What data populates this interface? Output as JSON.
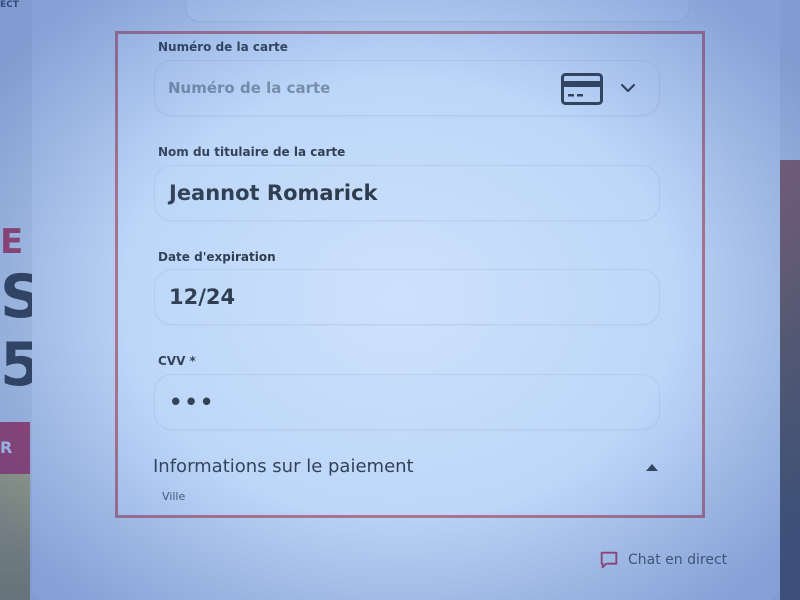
{
  "background_page": {
    "top_left_text": "ECT",
    "red_letter": "E",
    "big_letter_1": "S",
    "big_letter_2": "5",
    "red_button_text": "R"
  },
  "form": {
    "card_number": {
      "label": "Numéro de la carte",
      "placeholder": "Numéro de la carte",
      "icon": "credit-card-icon",
      "dropdown_icon": "chevron-down-icon"
    },
    "cardholder_name": {
      "label": "Nom du titulaire de la carte",
      "value": "Jeannot Romarick"
    },
    "expiration": {
      "label": "Date d'expiration",
      "value": "12/24"
    },
    "cvv": {
      "label": "CVV *",
      "value": "•••"
    },
    "payment_section": {
      "title": "Informations sur le paiement",
      "toggle_icon": "caret-up-icon",
      "first_field_label": "Ville"
    }
  },
  "chat": {
    "label": "Chat en direct",
    "icon": "chat-bubble-icon",
    "icon_color": "#c8102e"
  },
  "colors": {
    "highlight_border": "#e0605e",
    "overlay_tint": "#8ab8f0"
  }
}
